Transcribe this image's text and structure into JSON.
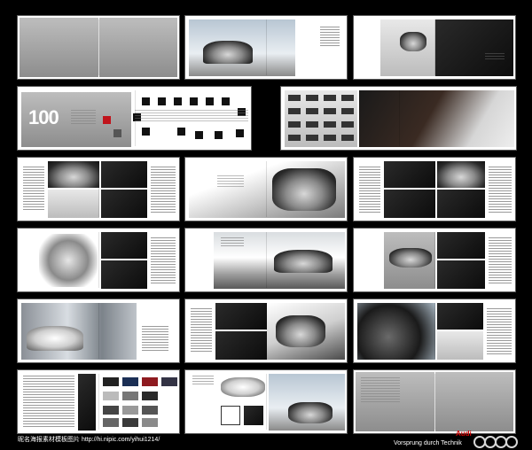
{
  "catalog": {
    "big_number": "100"
  },
  "footer": {
    "watermark": "昵名海报素材模板图片 http://hi.nipic.com/yihui1214/",
    "brand": "Audi",
    "tagline": "Vorsprung durch Technik"
  },
  "colors": {
    "background": "#000000",
    "accent": "#c0141c",
    "rings": "#d8d8d8"
  }
}
